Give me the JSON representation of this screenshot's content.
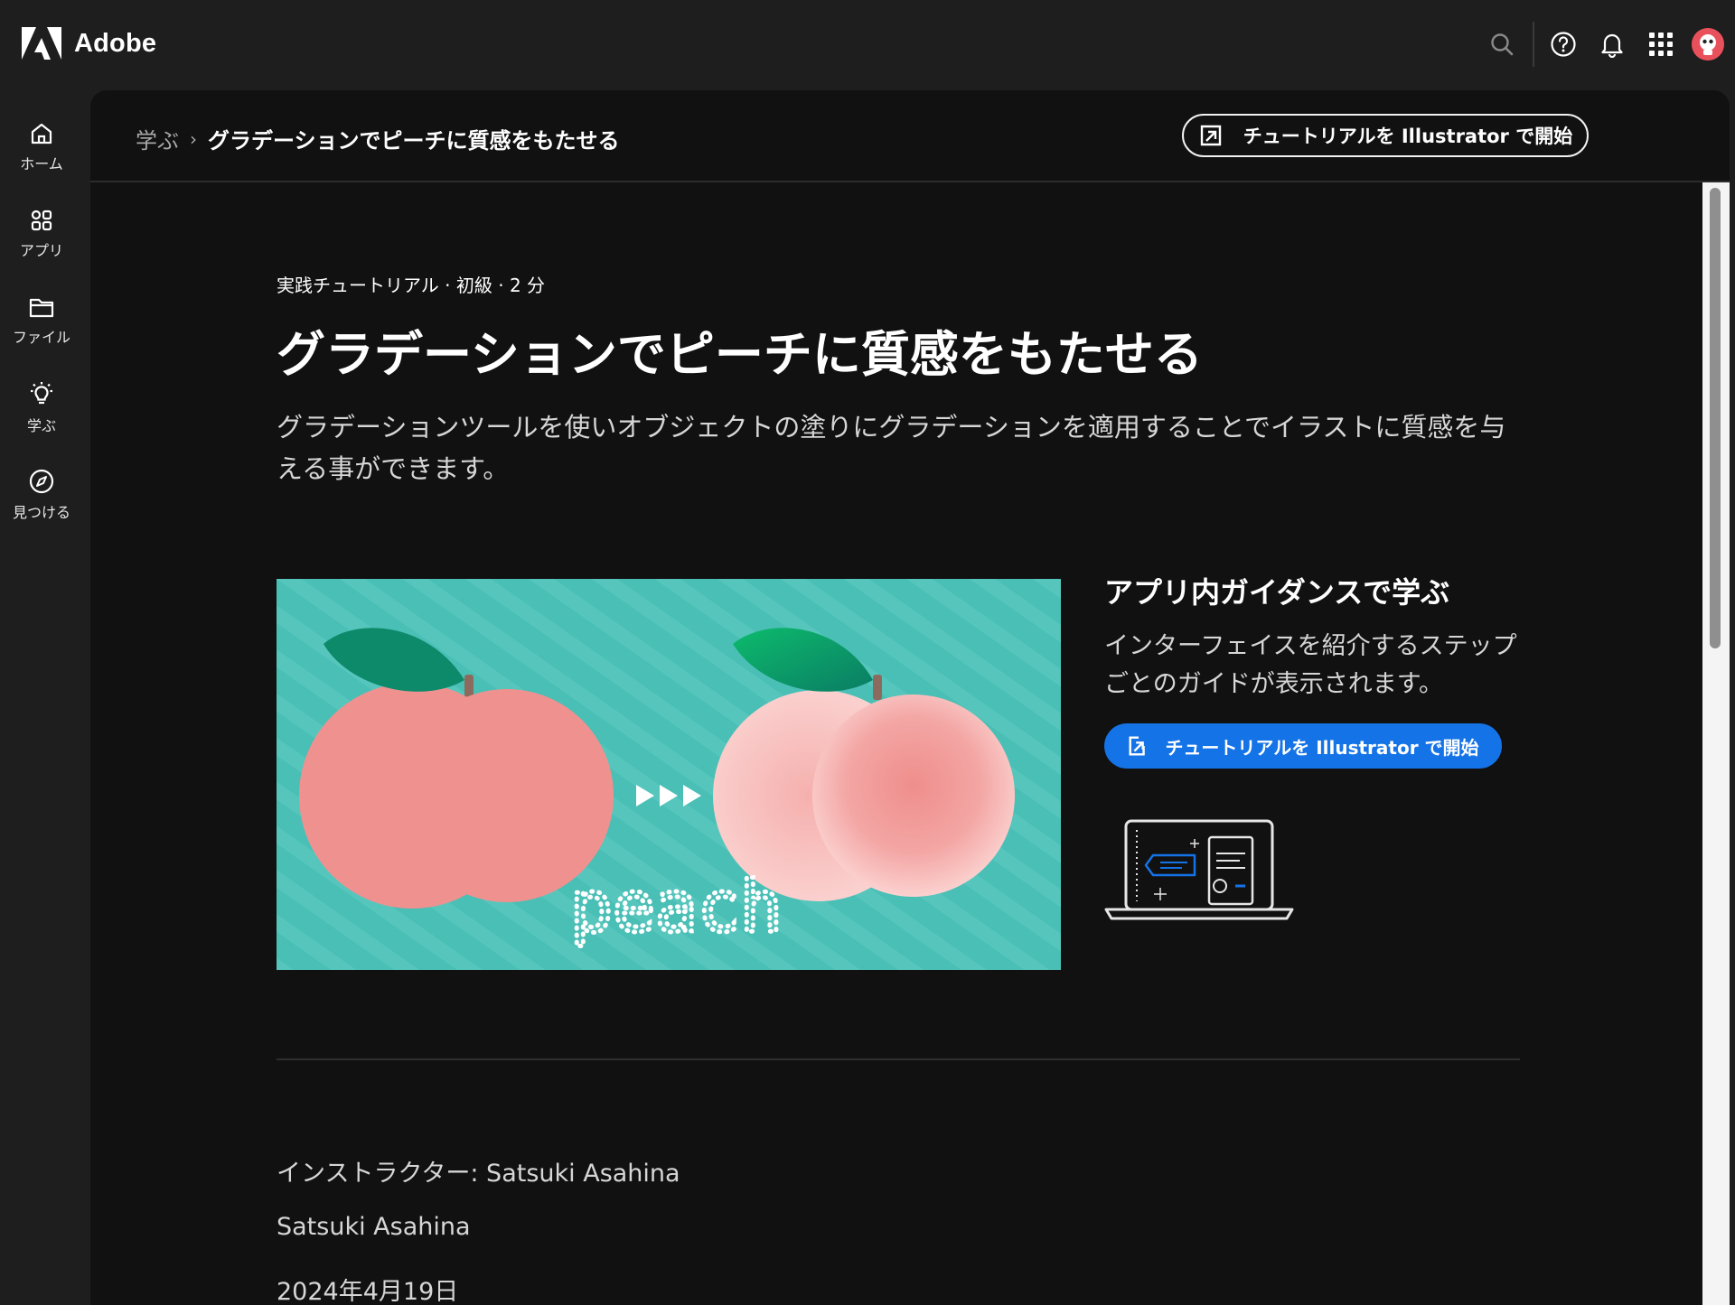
{
  "app": {
    "brand": "Adobe"
  },
  "topbar": {
    "icons": [
      "search-icon",
      "help-icon",
      "bell-icon",
      "apps-grid-icon",
      "avatar"
    ]
  },
  "rail": {
    "items": [
      {
        "label": "ホーム",
        "icon": "home-icon"
      },
      {
        "label": "アプリ",
        "icon": "apps-icon"
      },
      {
        "label": "ファイル",
        "icon": "folder-icon"
      },
      {
        "label": "学ぶ",
        "icon": "lightbulb-icon"
      },
      {
        "label": "見つける",
        "icon": "compass-icon"
      }
    ]
  },
  "breadcrumb": {
    "root": "学ぶ",
    "separator": "›",
    "current": "グラデーションでピーチに質感をもたせる"
  },
  "header_button": {
    "label": "チュートリアルを Illustrator で開始"
  },
  "tutorial": {
    "meta": "実践チュートリアル · 初級 · 2 分",
    "title": "グラデーションでピーチに質感をもたせる",
    "description": "グラデーションツールを使いオブジェクトの塗りにグラデーションを適用することでイラストに質感を与える事ができます。",
    "hero_text": "peach"
  },
  "guide": {
    "title": "アプリ内ガイダンスで学ぶ",
    "text": "インターフェイスを紹介するステップごとのガイドが表示されます。",
    "button_label": "チュートリアルを Illustrator で開始"
  },
  "info": {
    "instructor": "インストラクター: Satsuki Asahina",
    "author": "Satsuki Asahina",
    "date": "2024年4月19日"
  },
  "colors": {
    "accent": "#1473e6",
    "teal": "#4abfb6",
    "peach": "#ef918f",
    "leaf": "#0d8a6a"
  }
}
